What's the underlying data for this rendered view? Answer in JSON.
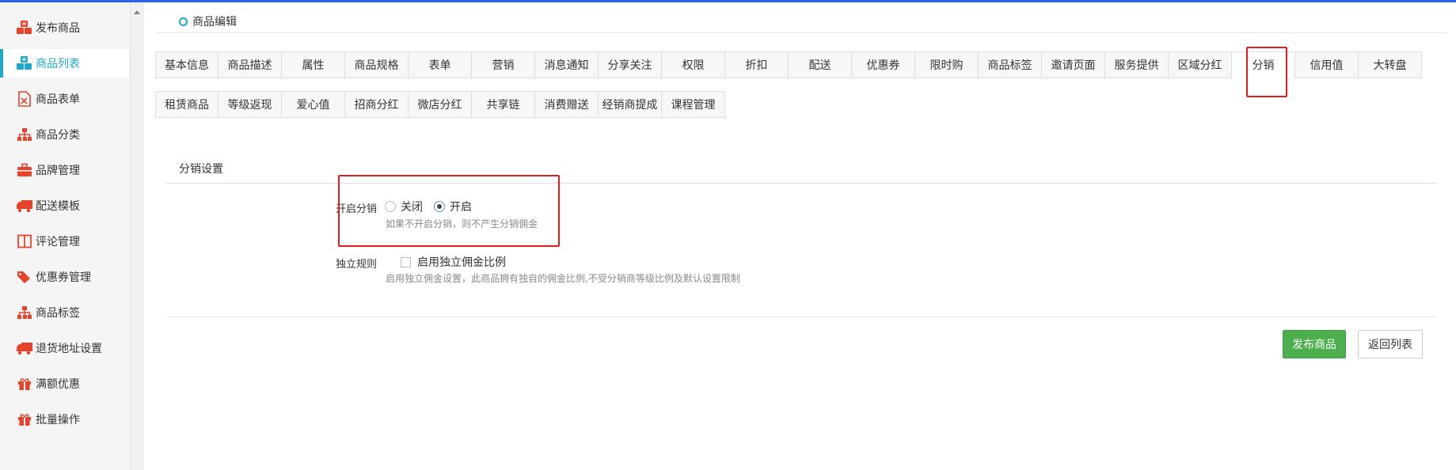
{
  "sidebar": {
    "items": [
      {
        "label": "发布商品",
        "icon": "cubes-icon"
      },
      {
        "label": "商品列表",
        "icon": "cubes-icon",
        "active": true
      },
      {
        "label": "商品表单",
        "icon": "file-excel-icon"
      },
      {
        "label": "商品分类",
        "icon": "sitemap-icon"
      },
      {
        "label": "品牌管理",
        "icon": "briefcase-icon"
      },
      {
        "label": "配送模板",
        "icon": "truck-icon"
      },
      {
        "label": "评论管理",
        "icon": "columns-icon"
      },
      {
        "label": "优惠券管理",
        "icon": "tags-icon"
      },
      {
        "label": "商品标签",
        "icon": "sitemap-icon"
      },
      {
        "label": "退货地址设置",
        "icon": "truck-icon"
      },
      {
        "label": "满额优惠",
        "icon": "gift-icon"
      },
      {
        "label": "批量操作",
        "icon": "gift-icon"
      }
    ]
  },
  "breadcrumb": {
    "label": "商品编辑"
  },
  "tabs": {
    "row1": [
      "基本信息",
      "商品描述",
      "属性",
      "商品规格",
      "表单",
      "营销",
      "消息通知",
      "分享关注",
      "权限",
      "折扣",
      "配送",
      "优惠券",
      "限时购",
      "商品标签",
      "邀请页面",
      "服务提供",
      "区域分红",
      "分销",
      "信用值",
      "大转盘"
    ],
    "row2": [
      "租赁商品",
      "等级返现",
      "爱心值",
      "招商分红",
      "微店分红",
      "共享链",
      "消费赠送",
      "经销商提成",
      "课程管理"
    ],
    "active": "分销"
  },
  "section": {
    "title": "分销设置"
  },
  "form": {
    "enable": {
      "label": "开启分销",
      "options": [
        "关闭",
        "开启"
      ],
      "selected": "开启",
      "hint": "如果不开启分销，则不产生分销佣金"
    },
    "rule": {
      "label": "独立规则",
      "checkbox_label": "启用独立佣金比例",
      "checked": false,
      "hint": "启用独立佣金设置，此商品拥有独自的佣金比例,不受分销商等级比例及默认设置限制"
    }
  },
  "buttons": {
    "publish": "发布商品",
    "back": "返回列表"
  },
  "colors": {
    "accent": "#1fa9c8",
    "primary_button": "#4cae4c",
    "highlight": "#e51b1b",
    "icon_red": "#e8432a"
  }
}
